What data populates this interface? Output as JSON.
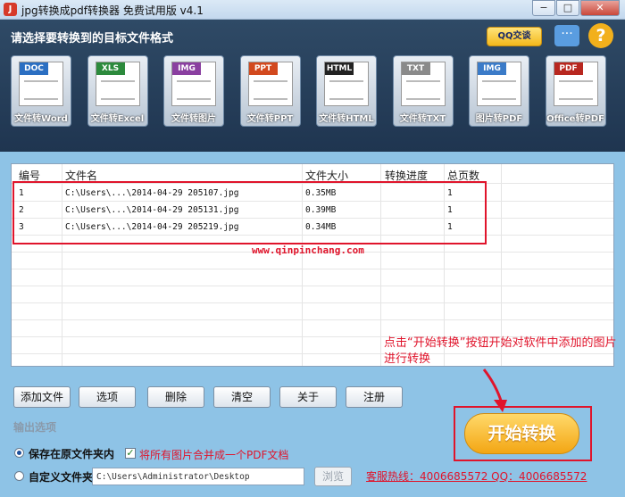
{
  "window": {
    "title": "jpg转换成pdf转换器 免费试用版 v4.1",
    "min_label": "−",
    "max_label": "□",
    "close_label": "✕"
  },
  "header": {
    "title": "请选择要转换到的目标文件格式",
    "qq_label": "QQ交谈",
    "help_label": "?"
  },
  "tools": [
    {
      "tag": "DOC",
      "label": "文件转Word",
      "color": "#2b6fc2"
    },
    {
      "tag": "XLS",
      "label": "文件转Excel",
      "color": "#2c8a3c"
    },
    {
      "tag": "IMG",
      "label": "文件转图片",
      "color": "#8a3fa0"
    },
    {
      "tag": "PPT",
      "label": "文件转PPT",
      "color": "#d2491e"
    },
    {
      "tag": "HTML",
      "label": "文件转HTML",
      "color": "#222222"
    },
    {
      "tag": "TXT",
      "label": "文件转TXT",
      "color": "#8a8a8a"
    },
    {
      "tag": "IMG",
      "label": "图片转PDF",
      "color": "#3b7bc8"
    },
    {
      "tag": "PDF",
      "label": "Office转PDF",
      "color": "#b8271f"
    }
  ],
  "table": {
    "headers": [
      "编号",
      "文件名",
      "文件大小",
      "转换进度",
      "总页数"
    ],
    "rows": [
      [
        "1",
        "C:\\Users\\...\\2014-04-29 205107.jpg",
        "0.35MB",
        "",
        "1"
      ],
      [
        "2",
        "C:\\Users\\...\\2014-04-29 205131.jpg",
        "0.39MB",
        "",
        "1"
      ],
      [
        "3",
        "C:\\Users\\...\\2014-04-29 205219.jpg",
        "0.34MB",
        "",
        "1"
      ]
    ]
  },
  "watermark": "www.qinpinchang.com",
  "annotation": "点击“开始转换”按钮开始对软件中添加的图片进行转换",
  "buttons": {
    "add": "添加文件",
    "options": "选项",
    "delete": "删除",
    "clear": "清空",
    "about": "关于",
    "register": "注册"
  },
  "output": {
    "section_label": "输出选项",
    "save_original": "保存在原文件夹内",
    "merge_label": "将所有图片合并成一个PDF文档",
    "custom_folder": "自定义文件夹",
    "path_value": "C:\\Users\\Administrator\\Desktop",
    "browse": "浏览"
  },
  "start_label": "开始转换",
  "hotline": "客服热线：4006685572 QQ：4006685572"
}
